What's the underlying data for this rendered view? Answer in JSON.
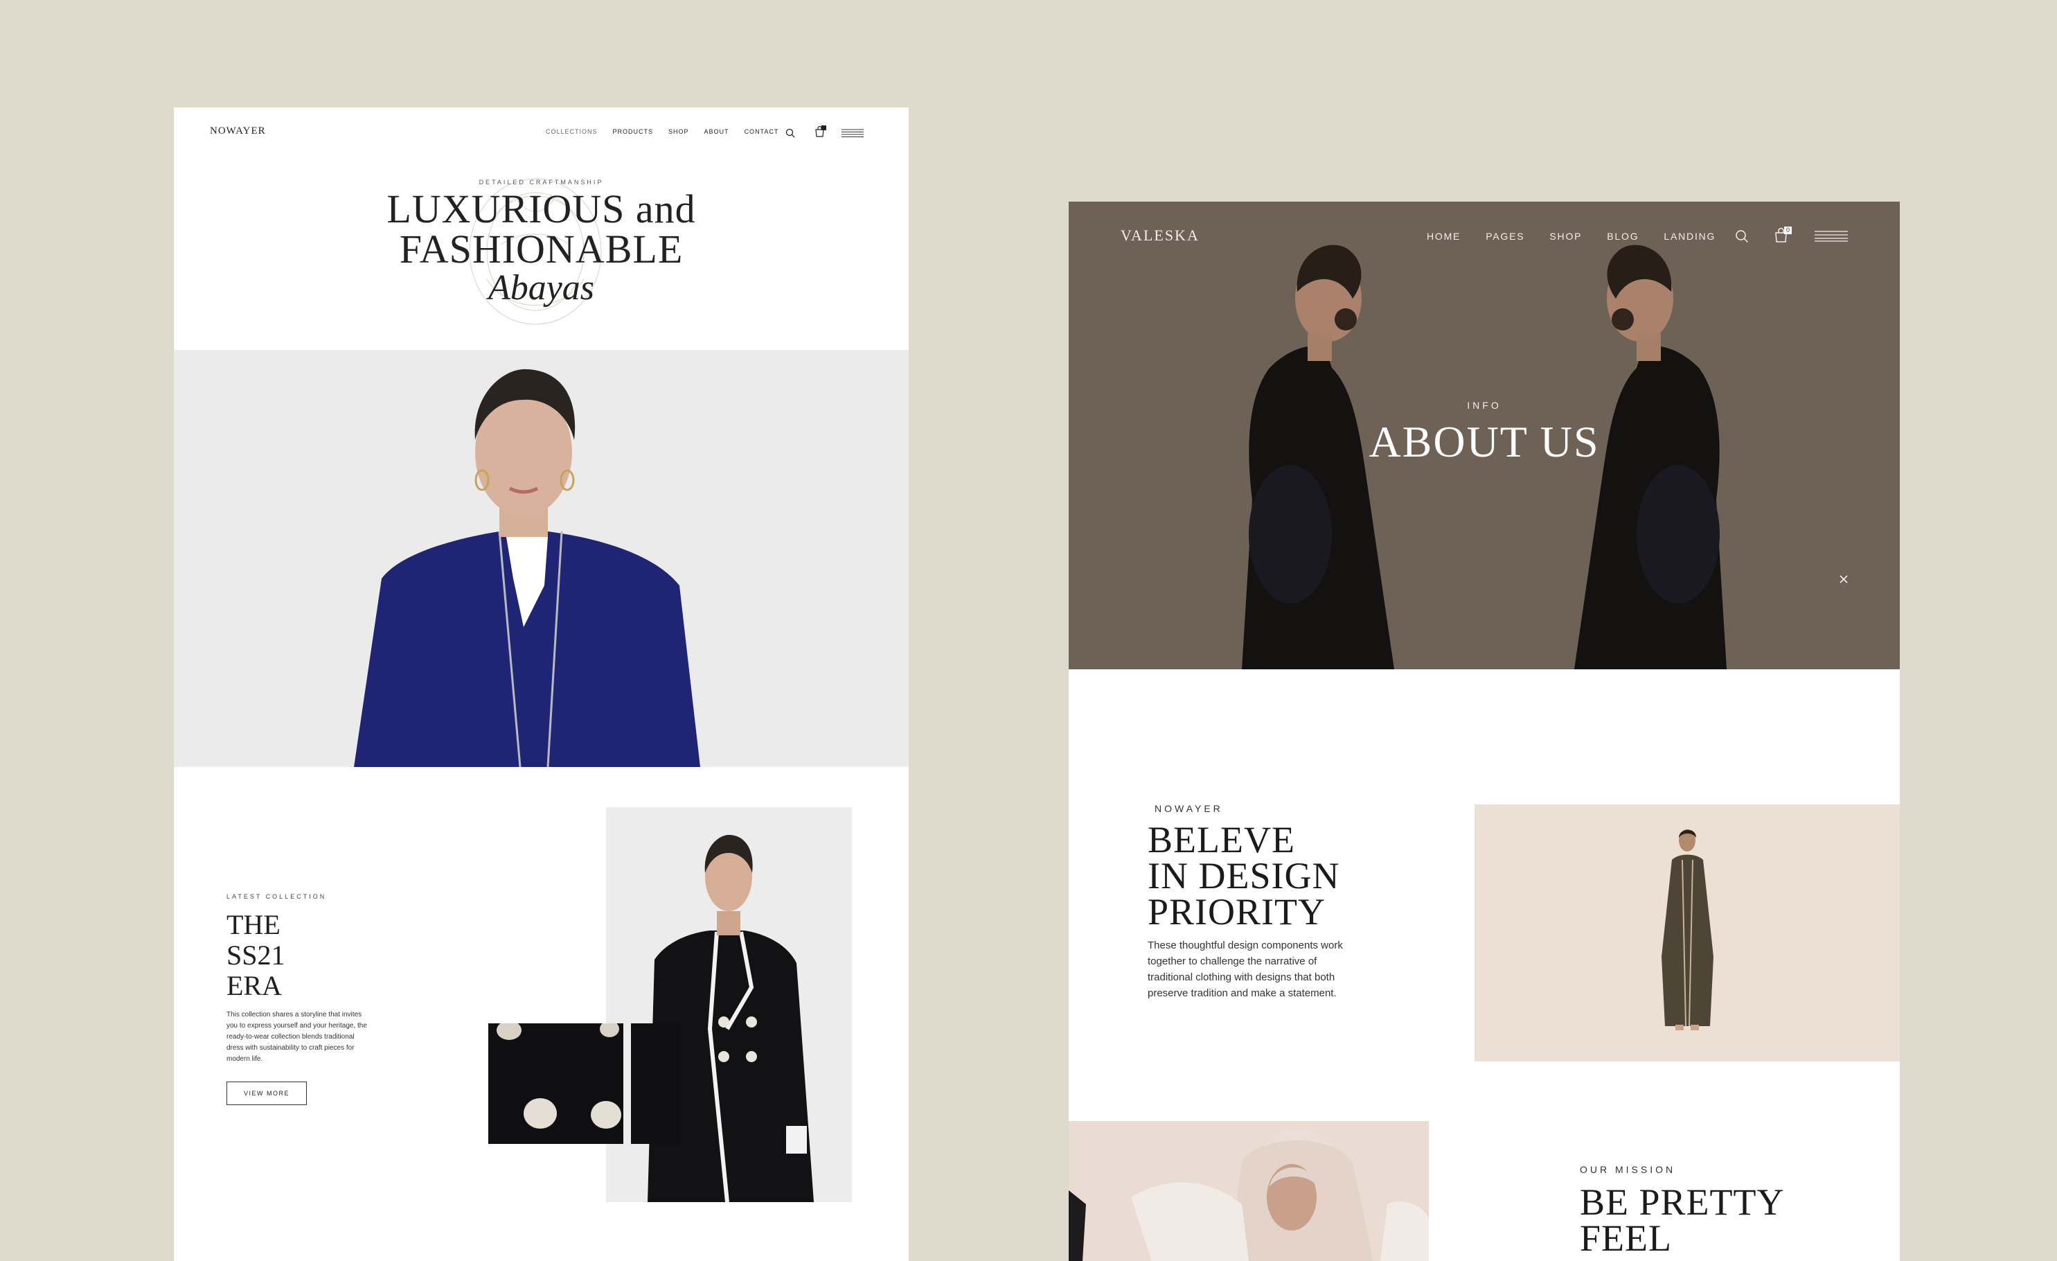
{
  "left_mockup": {
    "brand": "NOWAYER",
    "nav": [
      "COLLECTIONS",
      "PRODUCTS",
      "SHOP",
      "ABOUT",
      "CONTACT"
    ],
    "cart_count": "",
    "hero": {
      "kicker": "DETAILED CRAFTMANSHIP",
      "title_line1": "LUXURIOUS and",
      "title_line2": "FASHIONABLE",
      "title_italic": "Abayas"
    },
    "latest": {
      "kicker": "LATEST COLLECTION",
      "title": "THE\nSS21\nERA",
      "description": "This collection shares a storyline that invites you to express yourself and your heritage, the ready-to-wear collection blends traditional dress with sustainability to craft pieces for modern life.",
      "button": "VIEW MORE"
    }
  },
  "right_mockup": {
    "brand": "VALESKA",
    "nav": [
      "HOME",
      "PAGES",
      "SHOP",
      "BLOG",
      "LANDING"
    ],
    "cart_count": "0",
    "hero": {
      "kicker": "INFO",
      "title": "ABOUT US"
    },
    "believe": {
      "kicker": "NOWAYER",
      "title": "BELEVE\nIN DESIGN\nPRIORITY",
      "description": "These thoughtful design components work together to challenge the narrative of traditional clothing with designs that both preserve tradition and make a statement."
    },
    "mission": {
      "kicker": "OUR MISSION",
      "title": "BE PRETTY\nFEEL"
    }
  },
  "colors": {
    "background": "#dedbcd",
    "hero_brown": "#776b5d",
    "abaya_navy": "#1f2475",
    "beige_panel": "#ecdfd3"
  },
  "icons": [
    "search-icon",
    "cart-icon",
    "menu-icon",
    "close-icon"
  ]
}
